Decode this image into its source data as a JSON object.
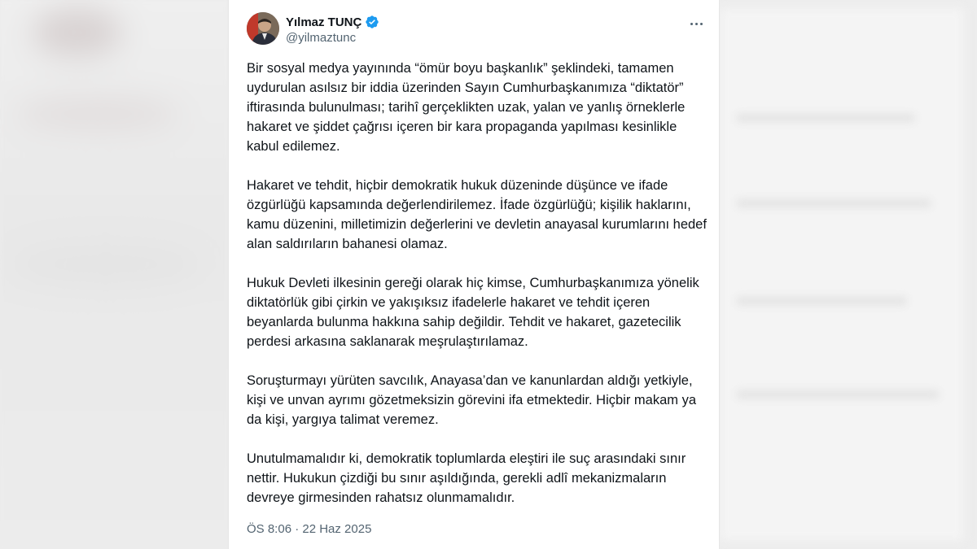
{
  "tweet": {
    "author": {
      "display_name": "Yılmaz TUNÇ",
      "handle": "@yilmaztunc",
      "verified": true,
      "verified_color": "#1d9bf0"
    },
    "paragraphs": [
      "Bir sosyal medya yayınında “ömür boyu başkanlık” şeklindeki, tamamen uydurulan asılsız bir iddia üzerinden Sayın Cumhurbaşkanımıza “diktatör” iftirasında bulunulması; tarihî gerçeklikten uzak, yalan ve yanlış örneklerle hakaret ve şiddet çağrısı içeren bir kara propaganda yapılması kesinlikle kabul edilemez.",
      "Hakaret ve tehdit, hiçbir demokratik hukuk düzeninde düşünce ve ifade özgürlüğü kapsamında değerlendirilemez. İfade özgürlüğü; kişilik haklarını, kamu düzenini, milletimizin değerlerini ve devletin anayasal kurumlarını hedef alan saldırıların bahanesi olamaz.",
      "Hukuk Devleti ilkesinin gereği olarak hiç kimse, Cumhurbaşkanımıza yönelik diktatörlük gibi çirkin ve yakışıksız ifadelerle hakaret ve tehdit içeren beyanlarda bulunma hakkına sahip değildir. Tehdit ve hakaret, gazetecilik perdesi arkasına saklanarak meşrulaştırılamaz.",
      "Soruşturmayı yürüten savcılık, Anayasa’dan ve kanunlardan aldığı yetkiyle, kişi ve unvan ayrımı gözetmeksizin görevini ifa etmektedir. Hiçbir makam ya da kişi, yargıya talimat veremez.",
      "Unutulmamalıdır ki, demokratik toplumlarda eleştiri ile suç arasındaki sınır nettir. Hukukun çizdiği bu sınır aşıldığında, gerekli adlî mekanizmaların devreye girmesinden rahatsız olunmamalıdır."
    ],
    "timestamp": "ÖS 8:06 · 22 Haz 2025"
  },
  "icons": {
    "verified": "verified-badge-icon",
    "more": "more-horizontal-icon"
  }
}
